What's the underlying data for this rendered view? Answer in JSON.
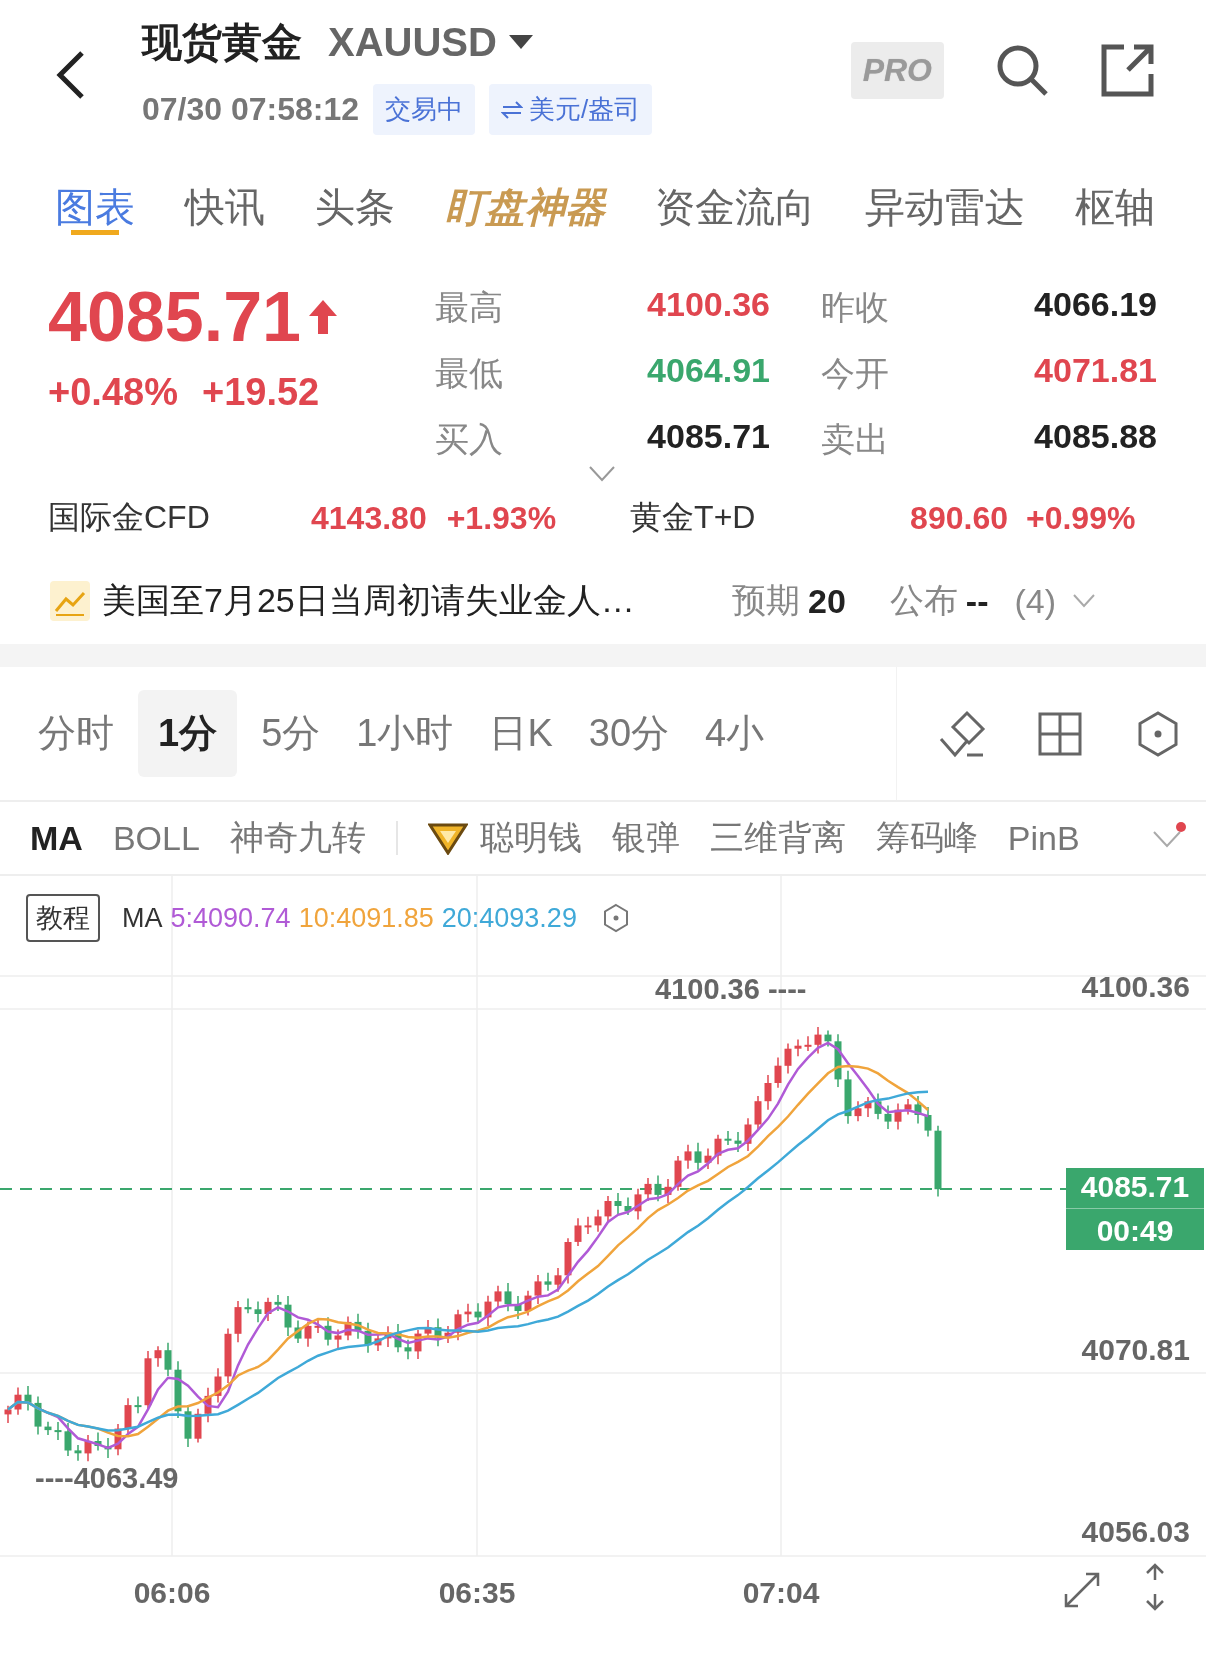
{
  "header": {
    "title": "现货黄金",
    "symbol": "XAUUSD",
    "time": "07/30 07:58:12",
    "status": "交易中",
    "unit": "美元/盎司",
    "pro": "PRO"
  },
  "tabs": [
    {
      "label": "图表",
      "selected": true,
      "kind": "normal"
    },
    {
      "label": "快讯",
      "selected": false,
      "kind": "normal"
    },
    {
      "label": "头条",
      "selected": false,
      "kind": "normal"
    },
    {
      "label": "盯盘神器",
      "selected": false,
      "kind": "featured"
    },
    {
      "label": "资金流向",
      "selected": false,
      "kind": "normal"
    },
    {
      "label": "异动雷达",
      "selected": false,
      "kind": "normal"
    },
    {
      "label": "枢轴",
      "selected": false,
      "kind": "normal"
    }
  ],
  "quote": {
    "price": "4085.71",
    "change_pct": "+0.48%",
    "change": "+19.52",
    "stats": [
      {
        "label": "最高",
        "value": "4100.36",
        "color": "#e0464f"
      },
      {
        "label": "昨收",
        "value": "4066.19",
        "color": "#222222"
      },
      {
        "label": "最低",
        "value": "4064.91",
        "color": "#3aa76d"
      },
      {
        "label": "今开",
        "value": "4071.81",
        "color": "#e0464f"
      },
      {
        "label": "买入",
        "value": "4085.71",
        "color": "#222222"
      },
      {
        "label": "卖出",
        "value": "4085.88",
        "color": "#222222"
      }
    ]
  },
  "related": [
    {
      "name": "国际金CFD",
      "price": "4143.80",
      "change": "+1.93%"
    },
    {
      "name": "黄金T+D",
      "price": "890.60",
      "change": "+0.99%"
    }
  ],
  "event": {
    "title": "美国至7月25日当周初请失业金人…",
    "expected_label": "预期",
    "expected": "20",
    "published_label": "公布",
    "published": "--",
    "count": "(4)"
  },
  "periods": [
    {
      "label": "分时",
      "selected": false
    },
    {
      "label": "1分",
      "selected": true
    },
    {
      "label": "5分",
      "selected": false
    },
    {
      "label": "1小时",
      "selected": false
    },
    {
      "label": "日K",
      "selected": false
    },
    {
      "label": "30分",
      "selected": false
    },
    {
      "label": "4小",
      "selected": false
    }
  ],
  "indicators": [
    {
      "label": "MA",
      "selected": true,
      "kind": "text"
    },
    {
      "label": "BOLL",
      "selected": false,
      "kind": "text"
    },
    {
      "label": "神奇九转",
      "selected": false,
      "kind": "text"
    },
    {
      "label": "聪明钱",
      "selected": false,
      "kind": "premium"
    },
    {
      "label": "银弹",
      "selected": false,
      "kind": "text"
    },
    {
      "label": "三维背离",
      "selected": false,
      "kind": "text"
    },
    {
      "label": "筹码峰",
      "selected": false,
      "kind": "text"
    },
    {
      "label": "PinB",
      "selected": false,
      "kind": "text"
    }
  ],
  "chart": {
    "tutorial": "教程",
    "ma_label": "MA",
    "ma": [
      {
        "text": "5:4090.74",
        "color": "#b05ad6"
      },
      {
        "text": "10:4091.85",
        "color": "#f0a43c"
      },
      {
        "text": "20:4093.29",
        "color": "#3fa9d8"
      }
    ],
    "high_mark": "4100.36 ----",
    "low_mark": "----4063.49",
    "price_tag": "4085.71",
    "countdown": "00:49",
    "y_labels": [
      "4100.36",
      "4070.81",
      "4056.03"
    ],
    "x_labels": [
      "06:06",
      "06:35",
      "07:04"
    ]
  }
}
